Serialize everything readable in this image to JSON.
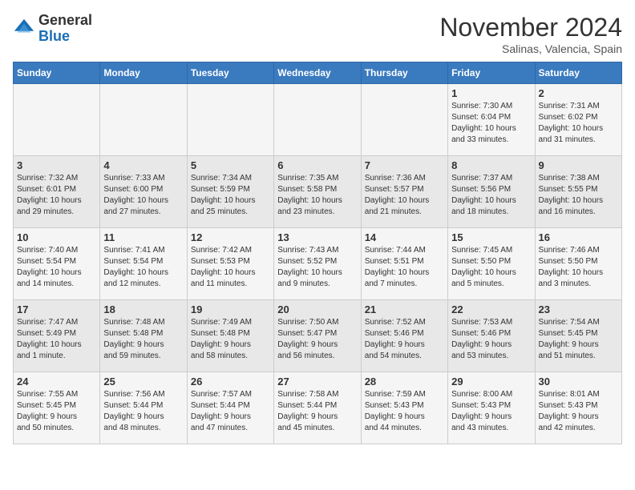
{
  "header": {
    "logo_general": "General",
    "logo_blue": "Blue",
    "month_title": "November 2024",
    "subtitle": "Salinas, Valencia, Spain"
  },
  "days_of_week": [
    "Sunday",
    "Monday",
    "Tuesday",
    "Wednesday",
    "Thursday",
    "Friday",
    "Saturday"
  ],
  "weeks": [
    [
      {
        "day": "",
        "info": ""
      },
      {
        "day": "",
        "info": ""
      },
      {
        "day": "",
        "info": ""
      },
      {
        "day": "",
        "info": ""
      },
      {
        "day": "",
        "info": ""
      },
      {
        "day": "1",
        "info": "Sunrise: 7:30 AM\nSunset: 6:04 PM\nDaylight: 10 hours\nand 33 minutes."
      },
      {
        "day": "2",
        "info": "Sunrise: 7:31 AM\nSunset: 6:02 PM\nDaylight: 10 hours\nand 31 minutes."
      }
    ],
    [
      {
        "day": "3",
        "info": "Sunrise: 7:32 AM\nSunset: 6:01 PM\nDaylight: 10 hours\nand 29 minutes."
      },
      {
        "day": "4",
        "info": "Sunrise: 7:33 AM\nSunset: 6:00 PM\nDaylight: 10 hours\nand 27 minutes."
      },
      {
        "day": "5",
        "info": "Sunrise: 7:34 AM\nSunset: 5:59 PM\nDaylight: 10 hours\nand 25 minutes."
      },
      {
        "day": "6",
        "info": "Sunrise: 7:35 AM\nSunset: 5:58 PM\nDaylight: 10 hours\nand 23 minutes."
      },
      {
        "day": "7",
        "info": "Sunrise: 7:36 AM\nSunset: 5:57 PM\nDaylight: 10 hours\nand 21 minutes."
      },
      {
        "day": "8",
        "info": "Sunrise: 7:37 AM\nSunset: 5:56 PM\nDaylight: 10 hours\nand 18 minutes."
      },
      {
        "day": "9",
        "info": "Sunrise: 7:38 AM\nSunset: 5:55 PM\nDaylight: 10 hours\nand 16 minutes."
      }
    ],
    [
      {
        "day": "10",
        "info": "Sunrise: 7:40 AM\nSunset: 5:54 PM\nDaylight: 10 hours\nand 14 minutes."
      },
      {
        "day": "11",
        "info": "Sunrise: 7:41 AM\nSunset: 5:54 PM\nDaylight: 10 hours\nand 12 minutes."
      },
      {
        "day": "12",
        "info": "Sunrise: 7:42 AM\nSunset: 5:53 PM\nDaylight: 10 hours\nand 11 minutes."
      },
      {
        "day": "13",
        "info": "Sunrise: 7:43 AM\nSunset: 5:52 PM\nDaylight: 10 hours\nand 9 minutes."
      },
      {
        "day": "14",
        "info": "Sunrise: 7:44 AM\nSunset: 5:51 PM\nDaylight: 10 hours\nand 7 minutes."
      },
      {
        "day": "15",
        "info": "Sunrise: 7:45 AM\nSunset: 5:50 PM\nDaylight: 10 hours\nand 5 minutes."
      },
      {
        "day": "16",
        "info": "Sunrise: 7:46 AM\nSunset: 5:50 PM\nDaylight: 10 hours\nand 3 minutes."
      }
    ],
    [
      {
        "day": "17",
        "info": "Sunrise: 7:47 AM\nSunset: 5:49 PM\nDaylight: 10 hours\nand 1 minute."
      },
      {
        "day": "18",
        "info": "Sunrise: 7:48 AM\nSunset: 5:48 PM\nDaylight: 9 hours\nand 59 minutes."
      },
      {
        "day": "19",
        "info": "Sunrise: 7:49 AM\nSunset: 5:48 PM\nDaylight: 9 hours\nand 58 minutes."
      },
      {
        "day": "20",
        "info": "Sunrise: 7:50 AM\nSunset: 5:47 PM\nDaylight: 9 hours\nand 56 minutes."
      },
      {
        "day": "21",
        "info": "Sunrise: 7:52 AM\nSunset: 5:46 PM\nDaylight: 9 hours\nand 54 minutes."
      },
      {
        "day": "22",
        "info": "Sunrise: 7:53 AM\nSunset: 5:46 PM\nDaylight: 9 hours\nand 53 minutes."
      },
      {
        "day": "23",
        "info": "Sunrise: 7:54 AM\nSunset: 5:45 PM\nDaylight: 9 hours\nand 51 minutes."
      }
    ],
    [
      {
        "day": "24",
        "info": "Sunrise: 7:55 AM\nSunset: 5:45 PM\nDaylight: 9 hours\nand 50 minutes."
      },
      {
        "day": "25",
        "info": "Sunrise: 7:56 AM\nSunset: 5:44 PM\nDaylight: 9 hours\nand 48 minutes."
      },
      {
        "day": "26",
        "info": "Sunrise: 7:57 AM\nSunset: 5:44 PM\nDaylight: 9 hours\nand 47 minutes."
      },
      {
        "day": "27",
        "info": "Sunrise: 7:58 AM\nSunset: 5:44 PM\nDaylight: 9 hours\nand 45 minutes."
      },
      {
        "day": "28",
        "info": "Sunrise: 7:59 AM\nSunset: 5:43 PM\nDaylight: 9 hours\nand 44 minutes."
      },
      {
        "day": "29",
        "info": "Sunrise: 8:00 AM\nSunset: 5:43 PM\nDaylight: 9 hours\nand 43 minutes."
      },
      {
        "day": "30",
        "info": "Sunrise: 8:01 AM\nSunset: 5:43 PM\nDaylight: 9 hours\nand 42 minutes."
      }
    ]
  ]
}
